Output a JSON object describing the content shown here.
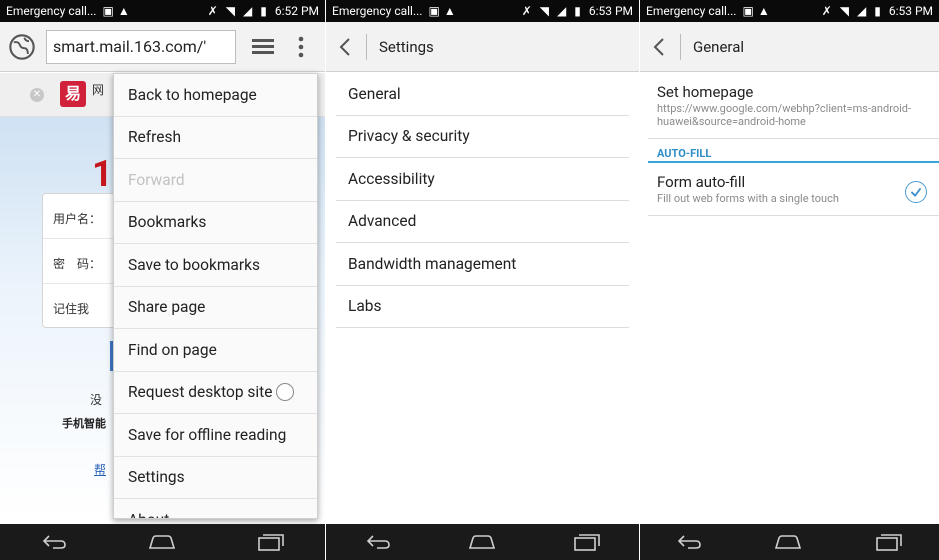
{
  "status_bars": [
    {
      "carrier": "Emergency call...",
      "time": "6:52 PM"
    },
    {
      "carrier": "Emergency call...",
      "time": "6:53 PM"
    },
    {
      "carrier": "Emergency call...",
      "time": "6:53 PM"
    }
  ],
  "browser": {
    "url": "smart.mail.163.com/'",
    "tab_title": "网",
    "tab_logo": "易",
    "page": {
      "logo_text": "1",
      "username_label": "用户名：",
      "password_label": "密　码：",
      "remember_label": "记住我",
      "text1": "没",
      "text2": "手机智能",
      "link": "帮"
    },
    "overflow_menu": [
      {
        "label": "Back to homepage",
        "enabled": true
      },
      {
        "label": "Refresh",
        "enabled": true
      },
      {
        "label": "Forward",
        "enabled": false
      },
      {
        "label": "Bookmarks",
        "enabled": true
      },
      {
        "label": "Save to bookmarks",
        "enabled": true
      },
      {
        "label": "Share page",
        "enabled": true
      },
      {
        "label": "Find on page",
        "enabled": true
      },
      {
        "label": "Request desktop site",
        "enabled": true,
        "radio": false
      },
      {
        "label": "Save for offline reading",
        "enabled": true
      },
      {
        "label": "Settings",
        "enabled": true
      },
      {
        "label": "About",
        "enabled": true
      }
    ]
  },
  "settings": {
    "title": "Settings",
    "items": [
      "General",
      "Privacy & security",
      "Accessibility",
      "Advanced",
      "Bandwidth management",
      "Labs"
    ]
  },
  "general": {
    "title": "General",
    "homepage": {
      "title": "Set homepage",
      "value": "https://www.google.com/webhp?client=ms-android-huawei&source=android-home"
    },
    "autofill_header": "AUTO-FILL",
    "form_autofill": {
      "title": "Form auto-fill",
      "subtitle": "Fill out web forms with a single touch",
      "checked": true
    }
  },
  "colors": {
    "accent": "#3aa6d8",
    "navbar": "#1a1a1a",
    "statusbar": "#0a0a0a"
  }
}
